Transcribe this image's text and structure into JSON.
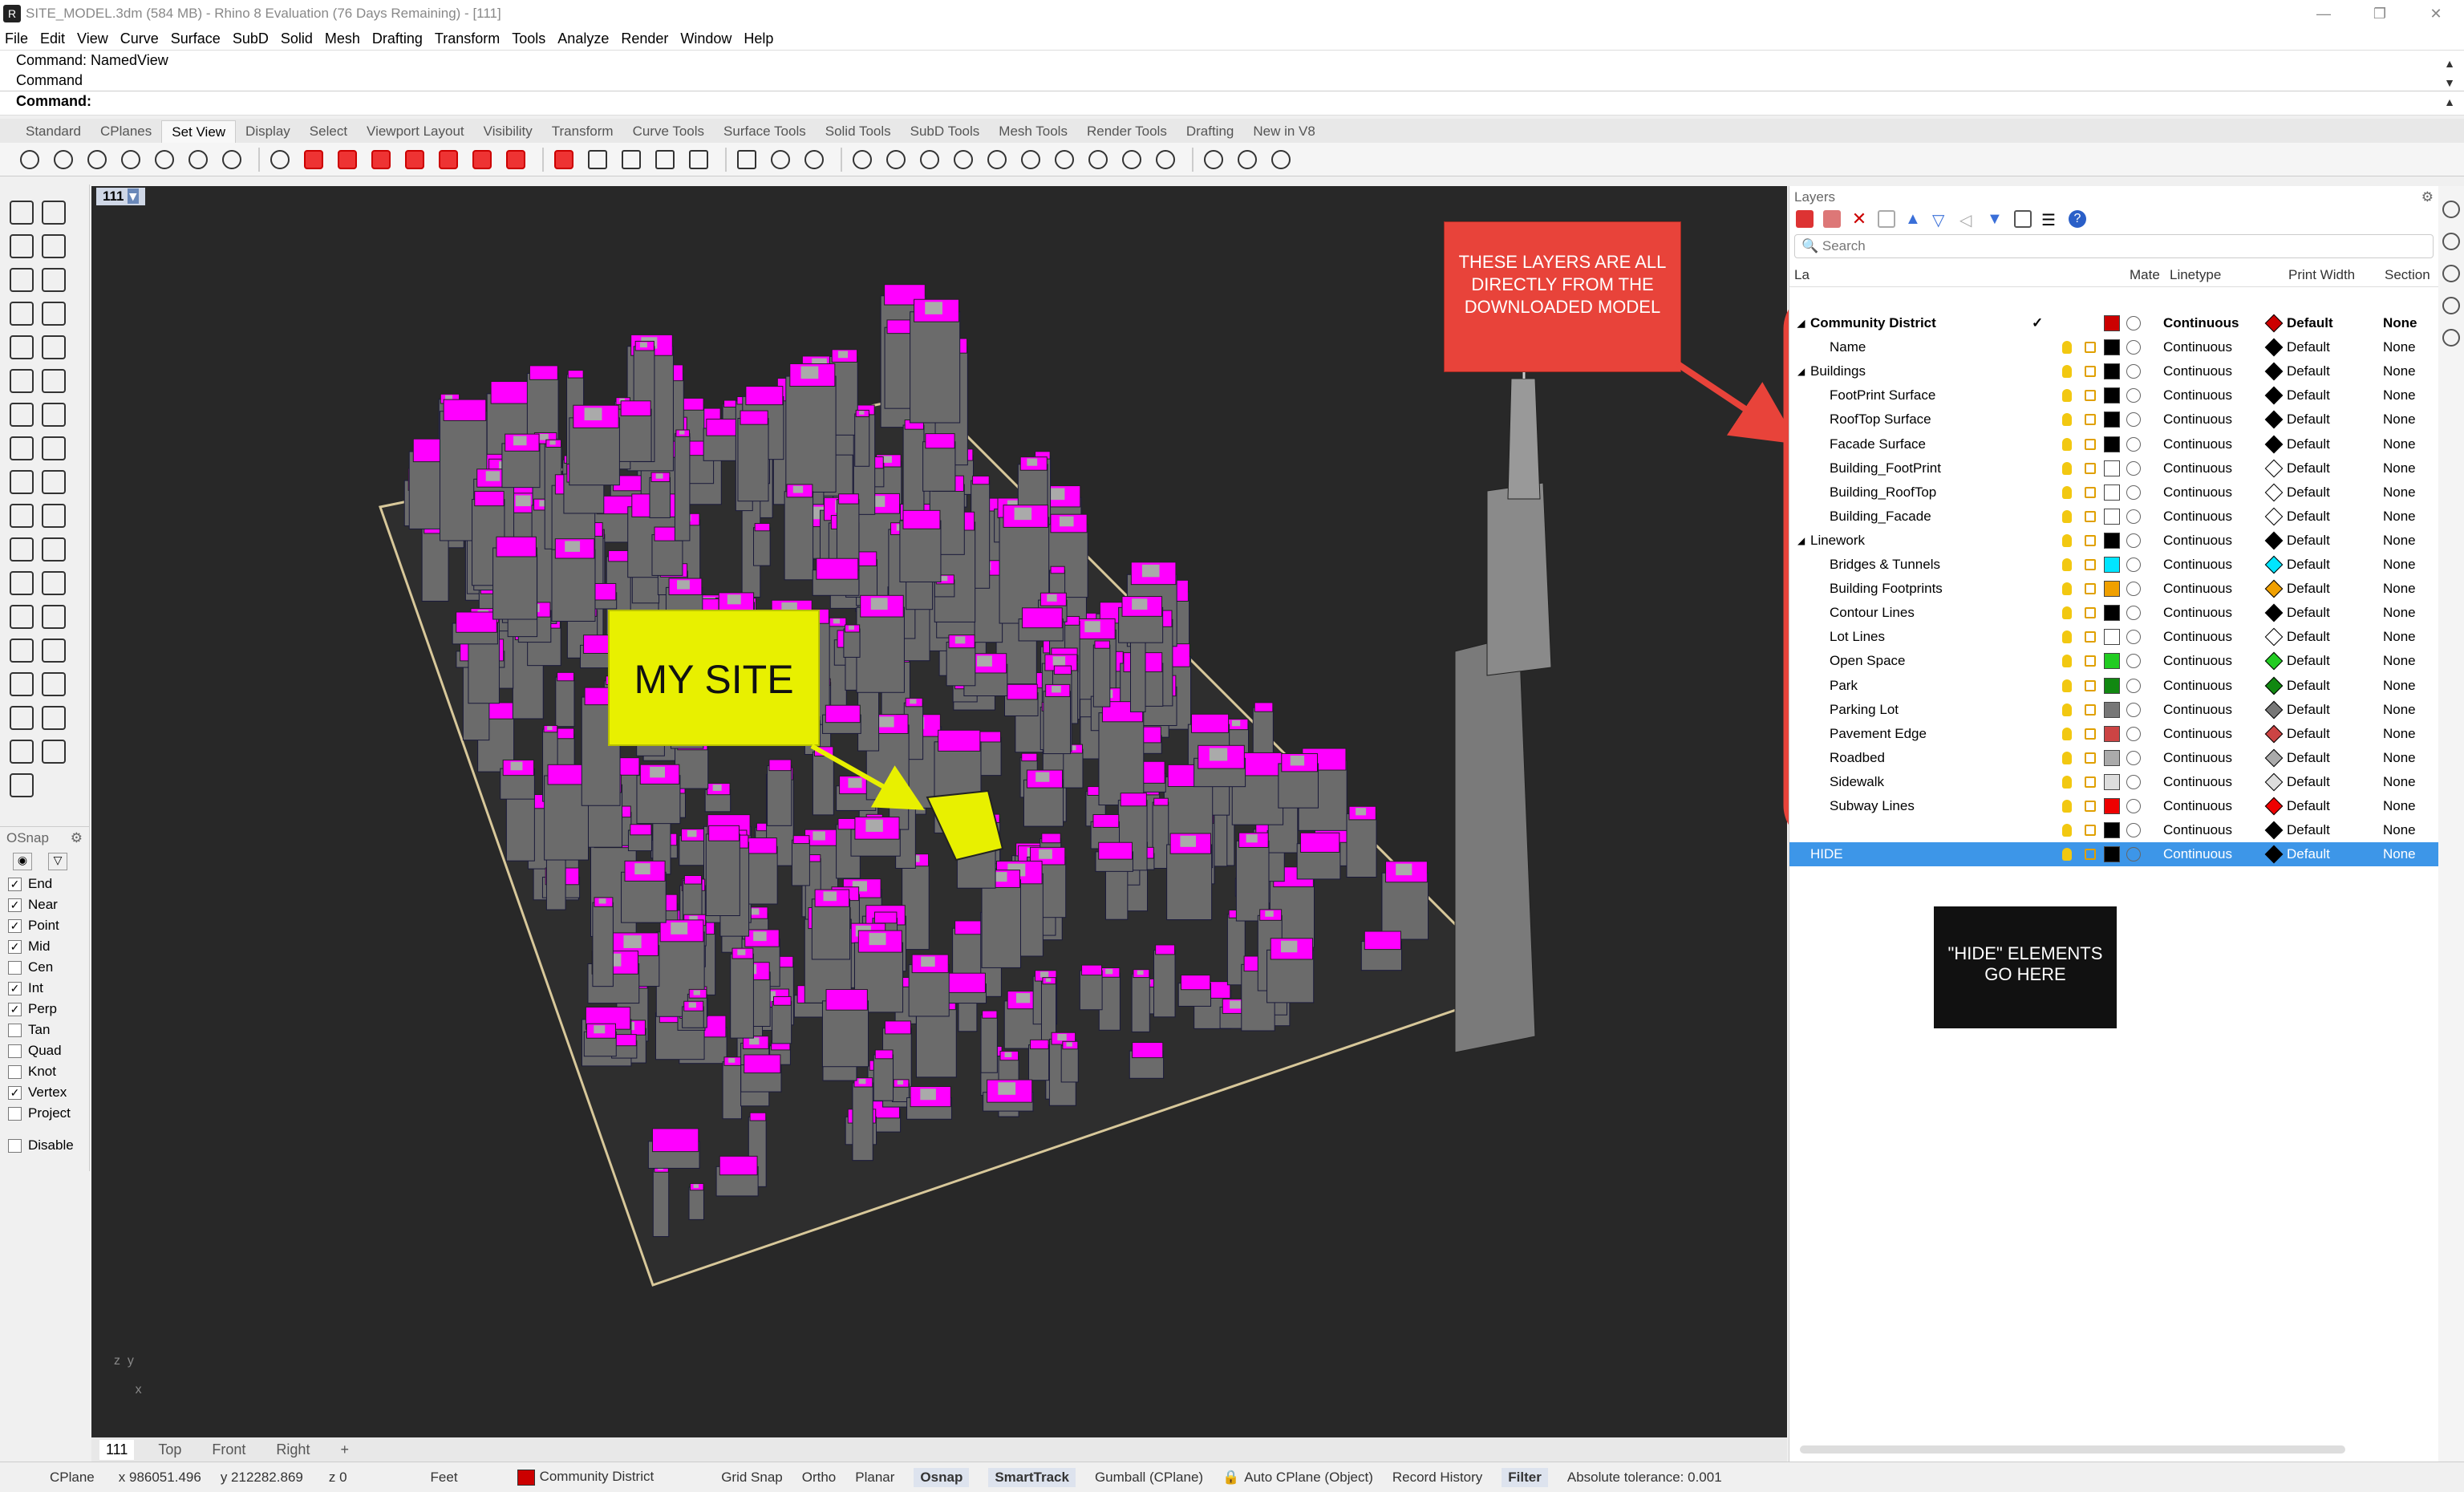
{
  "titlebar": {
    "title": "SITE_MODEL.3dm (584 MB) - Rhino 8 Evaluation (76 Days Remaining) - [111]"
  },
  "menu": [
    "File",
    "Edit",
    "View",
    "Curve",
    "Surface",
    "SubD",
    "Solid",
    "Mesh",
    "Drafting",
    "Transform",
    "Tools",
    "Analyze",
    "Render",
    "Window",
    "Help"
  ],
  "command": {
    "line1": "Command: NamedView",
    "line2": "Command",
    "prompt": "Command:"
  },
  "tabs": [
    "Standard",
    "CPlanes",
    "Set View",
    "Display",
    "Select",
    "Viewport Layout",
    "Visibility",
    "Transform",
    "Curve Tools",
    "Surface Tools",
    "Solid Tools",
    "SubD Tools",
    "Mesh Tools",
    "Render Tools",
    "Drafting",
    "New in V8"
  ],
  "active_tab": "Set View",
  "viewport": {
    "label": "111",
    "axes_y": "y",
    "axes_z": "z",
    "axes_x": "x"
  },
  "viewtabs": [
    "111",
    "Top",
    "Front",
    "Right",
    "+"
  ],
  "osnap": {
    "title": "OSnap",
    "items": [
      {
        "label": "End",
        "checked": true
      },
      {
        "label": "Near",
        "checked": true
      },
      {
        "label": "Point",
        "checked": true
      },
      {
        "label": "Mid",
        "checked": true
      },
      {
        "label": "Cen",
        "checked": false
      },
      {
        "label": "Int",
        "checked": true
      },
      {
        "label": "Perp",
        "checked": true
      },
      {
        "label": "Tan",
        "checked": false
      },
      {
        "label": "Quad",
        "checked": false
      },
      {
        "label": "Knot",
        "checked": false
      },
      {
        "label": "Vertex",
        "checked": true
      },
      {
        "label": "Project",
        "checked": false
      }
    ],
    "disable": "Disable"
  },
  "layers": {
    "title": "Layers",
    "search_placeholder": "Search",
    "col_name": "La",
    "col_mat": "Mate",
    "col_linetype": "Linetype",
    "col_printwidth": "Print Width",
    "col_section": "Section",
    "rows": [
      {
        "name": "Community District",
        "indent": 0,
        "expander": "◢",
        "current": "✓",
        "color": "#cc0000",
        "linetype": "Continuous",
        "printwidth": "Default",
        "section": "None",
        "dia": "#cc0000",
        "bold": true
      },
      {
        "name": "Name",
        "indent": 1,
        "color": "#000000",
        "linetype": "Continuous",
        "printwidth": "Default",
        "section": "None",
        "dia": "#000000"
      },
      {
        "name": "Buildings",
        "indent": 0,
        "expander": "◢",
        "color": "#000000",
        "linetype": "Continuous",
        "printwidth": "Default",
        "section": "None",
        "dia": "#000000"
      },
      {
        "name": "FootPrint Surface",
        "indent": 1,
        "color": "#000000",
        "linetype": "Continuous",
        "printwidth": "Default",
        "section": "None",
        "dia": "#000000"
      },
      {
        "name": "RoofTop Surface",
        "indent": 1,
        "color": "#000000",
        "linetype": "Continuous",
        "printwidth": "Default",
        "section": "None",
        "dia": "#000000"
      },
      {
        "name": "Facade Surface",
        "indent": 1,
        "color": "#000000",
        "linetype": "Continuous",
        "printwidth": "Default",
        "section": "None",
        "dia": "#000000"
      },
      {
        "name": "Building_FootPrint",
        "indent": 1,
        "color": "#ffffff",
        "linetype": "Continuous",
        "printwidth": "Default",
        "section": "None",
        "dia": "#ffffff"
      },
      {
        "name": "Building_RoofTop",
        "indent": 1,
        "color": "#ffffff",
        "linetype": "Continuous",
        "printwidth": "Default",
        "section": "None",
        "dia": "#ffffff"
      },
      {
        "name": "Building_Facade",
        "indent": 1,
        "color": "#ffffff",
        "linetype": "Continuous",
        "printwidth": "Default",
        "section": "None",
        "dia": "#ffffff"
      },
      {
        "name": "Linework",
        "indent": 0,
        "expander": "◢",
        "color": "#000000",
        "linetype": "Continuous",
        "printwidth": "Default",
        "section": "None",
        "dia": "#000000"
      },
      {
        "name": "Bridges & Tunnels",
        "indent": 1,
        "color": "#00e5ff",
        "linetype": "Continuous",
        "printwidth": "Default",
        "section": "None",
        "dia": "#00e5ff"
      },
      {
        "name": "Building Footprints",
        "indent": 1,
        "color": "#f0a000",
        "linetype": "Continuous",
        "printwidth": "Default",
        "section": "None",
        "dia": "#f0a000"
      },
      {
        "name": "Contour Lines",
        "indent": 1,
        "color": "#000000",
        "linetype": "Continuous",
        "printwidth": "Default",
        "section": "None",
        "dia": "#000000"
      },
      {
        "name": "Lot Lines",
        "indent": 1,
        "color": "#ffffff",
        "linetype": "Continuous",
        "printwidth": "Default",
        "section": "None",
        "dia": "#ffffff"
      },
      {
        "name": "Open Space",
        "indent": 1,
        "color": "#22cc22",
        "linetype": "Continuous",
        "printwidth": "Default",
        "section": "None",
        "dia": "#22cc22"
      },
      {
        "name": "Park",
        "indent": 1,
        "color": "#118811",
        "linetype": "Continuous",
        "printwidth": "Default",
        "section": "None",
        "dia": "#118811"
      },
      {
        "name": "Parking Lot",
        "indent": 1,
        "color": "#777777",
        "linetype": "Continuous",
        "printwidth": "Default",
        "section": "None",
        "dia": "#777777"
      },
      {
        "name": "Pavement Edge",
        "indent": 1,
        "color": "#cc4444",
        "linetype": "Continuous",
        "printwidth": "Default",
        "section": "None",
        "dia": "#cc4444"
      },
      {
        "name": "Roadbed",
        "indent": 1,
        "color": "#aaaaaa",
        "linetype": "Continuous",
        "printwidth": "Default",
        "section": "None",
        "dia": "#aaaaaa"
      },
      {
        "name": "Sidewalk",
        "indent": 1,
        "color": "#dddddd",
        "linetype": "Continuous",
        "printwidth": "Default",
        "section": "None",
        "dia": "#dddddd"
      },
      {
        "name": "Subway Lines",
        "indent": 1,
        "color": "#ee0000",
        "linetype": "Continuous",
        "printwidth": "Default",
        "section": "None",
        "dia": "#ee0000"
      },
      {
        "name": "",
        "indent": 1,
        "color": "#000000",
        "linetype": "Continuous",
        "printwidth": "Default",
        "section": "None",
        "dia": "#000000"
      },
      {
        "name": "HIDE",
        "indent": 0,
        "color": "#000000",
        "linetype": "Continuous",
        "printwidth": "Default",
        "section": "None",
        "dia": "#000000",
        "selected": true
      }
    ]
  },
  "annotations": {
    "layers_note": "THESE LAYERS ARE ALL DIRECTLY FROM THE DOWNLOADED MODEL",
    "my_site": "MY SITE",
    "hide_note": "\"HIDE\" ELEMENTS GO HERE"
  },
  "status": {
    "cplane": "CPlane",
    "x": "x 986051.496",
    "y": "y 212282.869",
    "z": "z 0",
    "units": "Feet",
    "layer": "Community District",
    "grid_snap": "Grid Snap",
    "ortho": "Ortho",
    "planar": "Planar",
    "osnap": "Osnap",
    "smarttrack": "SmartTrack",
    "gumball": "Gumball (CPlane)",
    "autocplane": "Auto CPlane (Object)",
    "record": "Record History",
    "filter": "Filter",
    "tolerance": "Absolute tolerance: 0.001"
  },
  "colors": {
    "building_magenta": "#ff00ff",
    "building_grey": "#6b6b6b",
    "annotation_red": "#e8433a",
    "annotation_yellow": "#e8f000",
    "selection_blue": "#3d96e8"
  }
}
